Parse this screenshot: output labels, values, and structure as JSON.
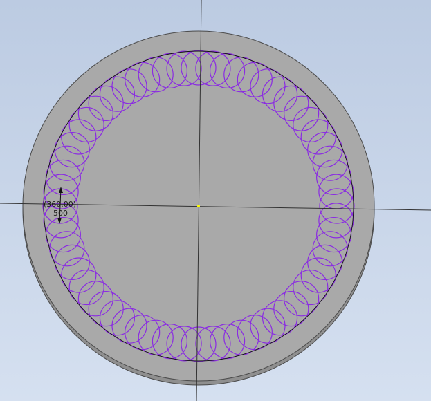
{
  "viewport": {
    "background_top": "#bccbe2",
    "background_bottom": "#d5e0f0"
  },
  "part": {
    "face_color": "#a9a9a9",
    "edge_color": "#4a4a4a",
    "side_color": "#8f8f8f"
  },
  "pattern": {
    "color": "#8a2be2",
    "circle_count": 60
  },
  "path_circle_color": "#111111",
  "axis_color": "#333333",
  "origin_color": "#ffff00",
  "dimension": {
    "angle_label": "(360.00)",
    "count_label": "500"
  }
}
